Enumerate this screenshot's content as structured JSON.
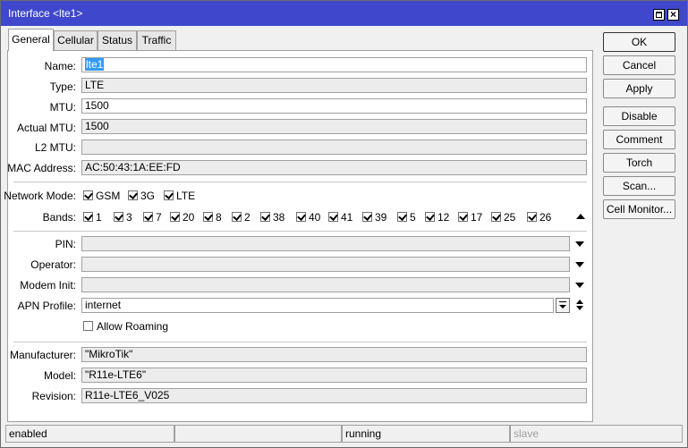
{
  "window": {
    "title": "Interface <lte1>"
  },
  "tabs": [
    "General",
    "Cellular",
    "Status",
    "Traffic"
  ],
  "fields": {
    "name": {
      "label": "Name:",
      "value": "lte1"
    },
    "type": {
      "label": "Type:",
      "value": "LTE"
    },
    "mtu": {
      "label": "MTU:",
      "value": "1500"
    },
    "actual_mtu": {
      "label": "Actual MTU:",
      "value": "1500"
    },
    "l2_mtu": {
      "label": "L2 MTU:",
      "value": ""
    },
    "mac": {
      "label": "MAC Address:",
      "value": "AC:50:43:1A:EE:FD"
    }
  },
  "network_mode": {
    "label": "Network Mode:",
    "options": [
      "GSM",
      "3G",
      "LTE"
    ]
  },
  "bands": {
    "label": "Bands:",
    "items": [
      "1",
      "3",
      "7",
      "20",
      "8",
      "2",
      "38",
      "40",
      "41",
      "39",
      "5",
      "12",
      "17",
      "25",
      "26"
    ]
  },
  "pin": {
    "label": "PIN:",
    "value": ""
  },
  "operator": {
    "label": "Operator:",
    "value": ""
  },
  "modem_init": {
    "label": "Modem Init:",
    "value": ""
  },
  "apn": {
    "label": "APN Profile:",
    "value": "internet"
  },
  "allow_roaming": {
    "label": "Allow Roaming",
    "checked": false
  },
  "info": {
    "manufacturer": {
      "label": "Manufacturer:",
      "value": "\"MikroTik\""
    },
    "model": {
      "label": "Model:",
      "value": "\"R11e-LTE6\""
    },
    "revision": {
      "label": "Revision:",
      "value": "R11e-LTE6_V025"
    }
  },
  "buttons": [
    "OK",
    "Cancel",
    "Apply",
    "Disable",
    "Comment",
    "Torch",
    "Scan...",
    "Cell Monitor..."
  ],
  "statusbar": [
    "enabled",
    "",
    "running",
    "slave"
  ]
}
